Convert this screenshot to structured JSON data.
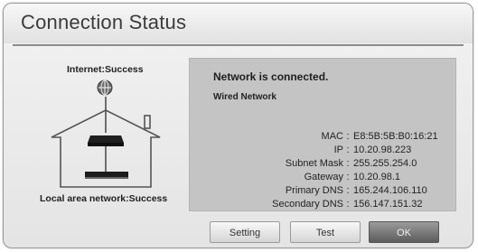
{
  "dialog": {
    "title": "Connection Status"
  },
  "left_panel": {
    "internet_label": "Internet:Success",
    "lan_label": "Local area network:Success"
  },
  "details": {
    "status_title": "Network is connected.",
    "network_type": "Wired Network",
    "rows": [
      {
        "label": "MAC",
        "value": "E8:5B:5B:B0:16:21"
      },
      {
        "label": "IP",
        "value": "10.20.98.223"
      },
      {
        "label": "Subnet Mask",
        "value": "255.255.254.0"
      },
      {
        "label": "Gateway",
        "value": "10.20.98.1"
      },
      {
        "label": "Primary DNS",
        "value": "165.244.106.110"
      },
      {
        "label": "Secondary DNS",
        "value": "156.147.151.32"
      }
    ]
  },
  "buttons": {
    "setting": "Setting",
    "test": "Test",
    "ok": "OK"
  }
}
